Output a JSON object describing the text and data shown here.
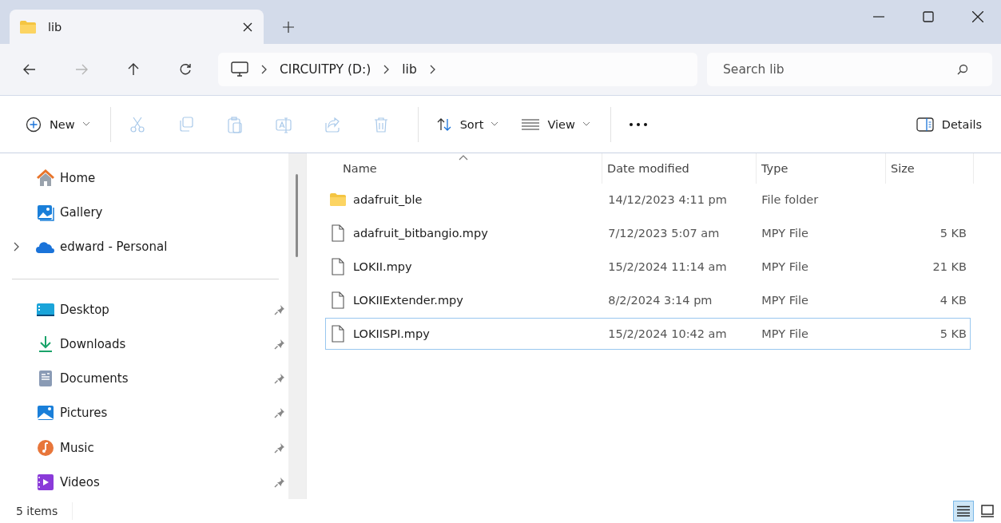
{
  "tab": {
    "title": "lib"
  },
  "nav": [
    {
      "kind": "back",
      "disabled": false
    },
    {
      "kind": "forward",
      "disabled": true
    },
    {
      "kind": "up",
      "disabled": false
    },
    {
      "kind": "refresh",
      "disabled": false
    }
  ],
  "breadcrumbs": [
    "CIRCUITPY (D:)",
    "lib"
  ],
  "search": {
    "placeholder": "Search lib"
  },
  "toolbar": {
    "new": "New",
    "actions": [
      {
        "kind": "cut",
        "disabled": true
      },
      {
        "kind": "copy",
        "disabled": true
      },
      {
        "kind": "paste",
        "disabled": true
      },
      {
        "kind": "rename",
        "disabled": true
      },
      {
        "kind": "share",
        "disabled": true
      },
      {
        "kind": "delete",
        "disabled": true
      }
    ],
    "sort": "Sort",
    "view": "View",
    "details": "Details"
  },
  "sidebar": {
    "groups": [
      [
        {
          "kind": "home",
          "label": "Home",
          "pinned": false,
          "expandable": false
        },
        {
          "kind": "gallery",
          "label": "Gallery",
          "pinned": false,
          "expandable": false
        },
        {
          "kind": "cloud",
          "label": "edward - Personal",
          "pinned": false,
          "expandable": true
        }
      ],
      [
        {
          "kind": "desktop",
          "label": "Desktop",
          "pinned": true,
          "expandable": false
        },
        {
          "kind": "downloads",
          "label": "Downloads",
          "pinned": true,
          "expandable": false
        },
        {
          "kind": "documents",
          "label": "Documents",
          "pinned": true,
          "expandable": false
        },
        {
          "kind": "pictures",
          "label": "Pictures",
          "pinned": true,
          "expandable": false
        },
        {
          "kind": "music",
          "label": "Music",
          "pinned": true,
          "expandable": false
        },
        {
          "kind": "videos",
          "label": "Videos",
          "pinned": true,
          "expandable": false
        }
      ]
    ]
  },
  "table": {
    "columns": [
      {
        "label": "Name",
        "sorted": true
      },
      {
        "label": "Date modified",
        "sorted": false
      },
      {
        "label": "Type",
        "sorted": false
      },
      {
        "label": "Size",
        "sorted": false
      }
    ],
    "rows": [
      {
        "kind": "folder",
        "name": "adafruit_ble",
        "date": "14/12/2023 4:11 pm",
        "type": "File folder",
        "focused": false
      },
      {
        "kind": "file",
        "name": "adafruit_bitbangio.mpy",
        "date": "7/12/2023 5:07 am",
        "type": "MPY File",
        "size": "5 KB",
        "focused": false
      },
      {
        "kind": "file",
        "name": "LOKII.mpy",
        "date": "15/2/2024 11:14 am",
        "type": "MPY File",
        "size": "21 KB",
        "focused": false
      },
      {
        "kind": "file",
        "name": "LOKIIExtender.mpy",
        "date": "8/2/2024 3:14 pm",
        "type": "MPY File",
        "size": "4 KB",
        "focused": false
      },
      {
        "kind": "file",
        "name": "LOKIISPI.mpy",
        "date": "15/2/2024 10:42 am",
        "type": "MPY File",
        "size": "5 KB",
        "focused": true
      }
    ]
  },
  "status_bar": {
    "count": "5 items",
    "views": [
      {
        "kind": "details",
        "selected": true
      },
      {
        "kind": "tiles",
        "selected": false
      }
    ]
  }
}
